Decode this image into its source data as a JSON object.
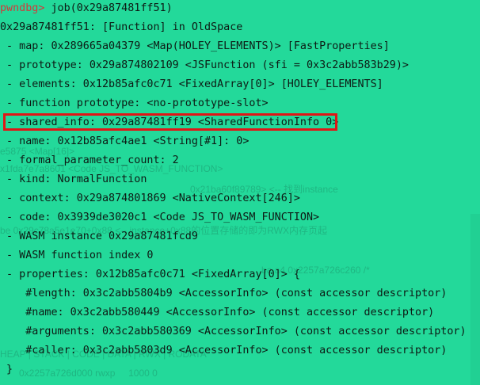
{
  "terminal": {
    "prompt": "pwndbg>",
    "command": " job(0x29a87481ff51)",
    "lines": [
      "0x29a87481ff51: [Function] in OldSpace",
      " - map: 0x289665a04379 <Map(HOLEY_ELEMENTS)> [FastProperties]",
      " - prototype: 0x29a874802109 <JSFunction (sfi = 0x3c2abb583b29)>",
      " - elements: 0x12b85afc0c71 <FixedArray[0]> [HOLEY_ELEMENTS]",
      " - function prototype: <no-prototype-slot>",
      " - shared_info: 0x29a87481ff19 <SharedFunctionInfo 0>",
      " - name: 0x12b85afc4ae1 <String[#1]: 0>",
      " - formal_parameter_count: 2",
      " - kind: NormalFunction",
      " - context: 0x29a874801869 <NativeContext[246]>",
      " - code: 0x3939de3020c1 <Code JS_TO_WASM_FUNCTION>",
      " - WASM instance 0x29a87481fcd9",
      " - WASM function index 0",
      " - properties: 0x12b85afc0c71 <FixedArray[0]> {",
      "    #length: 0x3c2abb5804b9 <AccessorInfo> (const accessor descriptor)",
      "    #name: 0x3c2abb580449 <AccessorInfo> (const accessor descriptor)",
      "    #arguments: 0x3c2abb580369 <AccessorInfo> (const accessor descriptor)",
      "    #caller: 0x3c2abb5803d9 <AccessorInfo> (const accessor descriptor)",
      " }"
    ]
  },
  "ghost": {
    "t1": "e5875 <Map[16]>",
    "t2": "x1fda7e7a8601 <Code JS_TO_WASM_FUNCTION>",
    "t3": "0x21ba60f89789> <-- 找到instance",
    "t4": "be 0x29c78a5e1e70+0x88 <-- instance+0x88的位置存储的即为RWX内存页起",
    "t5": "ba a4 0x2257a726c260 /*",
    "t6": "0x2257a726d000 rwxp     1000 0",
    "t7": "HEAP | STACK | CODE | DATA | RWX | RODATA"
  }
}
